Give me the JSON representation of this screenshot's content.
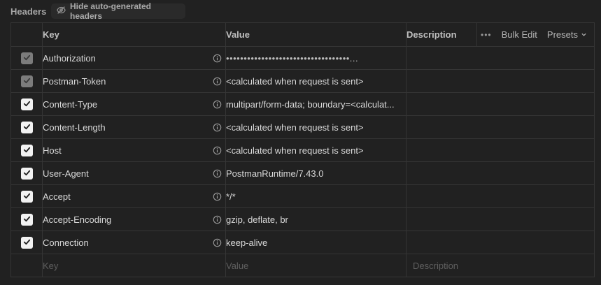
{
  "header": {
    "title": "Headers",
    "hide_button": "Hide auto-generated headers"
  },
  "table": {
    "columns": {
      "key": "Key",
      "value": "Value",
      "description": "Description"
    },
    "actions": {
      "more": "•••",
      "bulk_edit": "Bulk Edit",
      "presets": "Presets"
    },
    "rows": [
      {
        "key": "Authorization",
        "value": "•••••••••••••••••••••••••••••••••••...",
        "checked": true,
        "locked": true
      },
      {
        "key": "Postman-Token",
        "value": "<calculated when request is sent>",
        "checked": true,
        "locked": true
      },
      {
        "key": "Content-Type",
        "value": "multipart/form-data; boundary=<calculat...",
        "checked": true,
        "locked": false
      },
      {
        "key": "Content-Length",
        "value": "<calculated when request is sent>",
        "checked": true,
        "locked": false
      },
      {
        "key": "Host",
        "value": "<calculated when request is sent>",
        "checked": true,
        "locked": false
      },
      {
        "key": "User-Agent",
        "value": "PostmanRuntime/7.43.0",
        "checked": true,
        "locked": false
      },
      {
        "key": "Accept",
        "value": "*/*",
        "checked": true,
        "locked": false
      },
      {
        "key": "Accept-Encoding",
        "value": "gzip, deflate, br",
        "checked": true,
        "locked": false
      },
      {
        "key": "Connection",
        "value": "keep-alive",
        "checked": true,
        "locked": false
      }
    ],
    "placeholders": {
      "key": "Key",
      "value": "Value",
      "description": "Description"
    }
  },
  "icons": {
    "hide": "eye-slash-icon",
    "info": "info-icon",
    "check": "check-icon",
    "chevron": "chevron-down-icon"
  },
  "colors": {
    "background": "#212121",
    "border": "#353535",
    "checkbox_on": "#f2f2f2",
    "checkbox_locked": "#7c7c7c",
    "placeholder": "#5f5f5f"
  }
}
